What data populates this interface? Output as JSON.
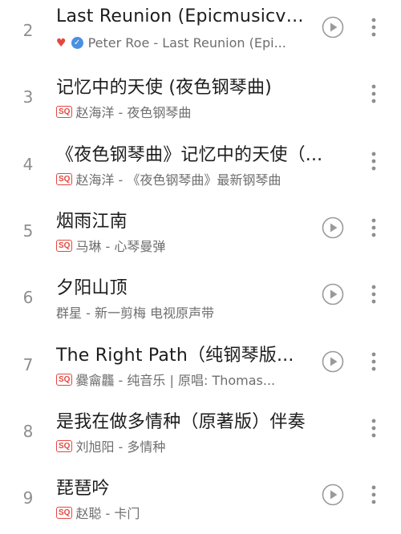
{
  "tracks": [
    {
      "num": "2",
      "title": "Last Reunion (Epicmusicvn...",
      "subtitle": "Peter Roe - Last Reunion (Epi...",
      "badges": [
        "heart",
        "verified"
      ],
      "has_play": true
    },
    {
      "num": "3",
      "title": "记忆中的天使 (夜色钢琴曲)",
      "subtitle": "赵海洋 - 夜色钢琴曲",
      "badges": [
        "SQ"
      ],
      "has_play": false
    },
    {
      "num": "4",
      "title": "《夜色钢琴曲》记忆中的天使（...",
      "subtitle": "赵海洋 - 《夜色钢琴曲》最新钢琴曲",
      "badges": [
        "SQ"
      ],
      "has_play": false
    },
    {
      "num": "5",
      "title": "烟雨江南",
      "subtitle": "马琳 - 心琴曼弹",
      "badges": [
        "SQ"
      ],
      "has_play": true
    },
    {
      "num": "6",
      "title": "夕阳山顶",
      "subtitle": "群星 - 新一剪梅 电视原声带",
      "badges": [],
      "has_play": true
    },
    {
      "num": "7",
      "title": "The Right Path（纯钢琴版...",
      "subtitle": "爨龠龘 - 纯音乐 | 原唱: Thomas...",
      "badges": [
        "SQ"
      ],
      "has_play": true
    },
    {
      "num": "8",
      "title": "是我在做多情种（原著版）伴奏",
      "subtitle": "刘旭阳 - 多情种",
      "badges": [
        "SQ"
      ],
      "has_play": false
    },
    {
      "num": "9",
      "title": "琵琶吟",
      "subtitle": "赵聪 - 卡门",
      "badges": [
        "SQ"
      ],
      "has_play": true
    }
  ],
  "labels": {
    "sq_badge": "SQ"
  },
  "icons": {
    "play": "play-circle-icon",
    "more": "more-vertical-icon",
    "heart": "heart-icon",
    "verified": "verified-check-icon"
  },
  "colors": {
    "sq_badge": "#e4473f",
    "heart": "#e4473f",
    "verified": "#4a90e2",
    "title": "#1c1c1c",
    "subtitle": "#6e6e6e"
  }
}
